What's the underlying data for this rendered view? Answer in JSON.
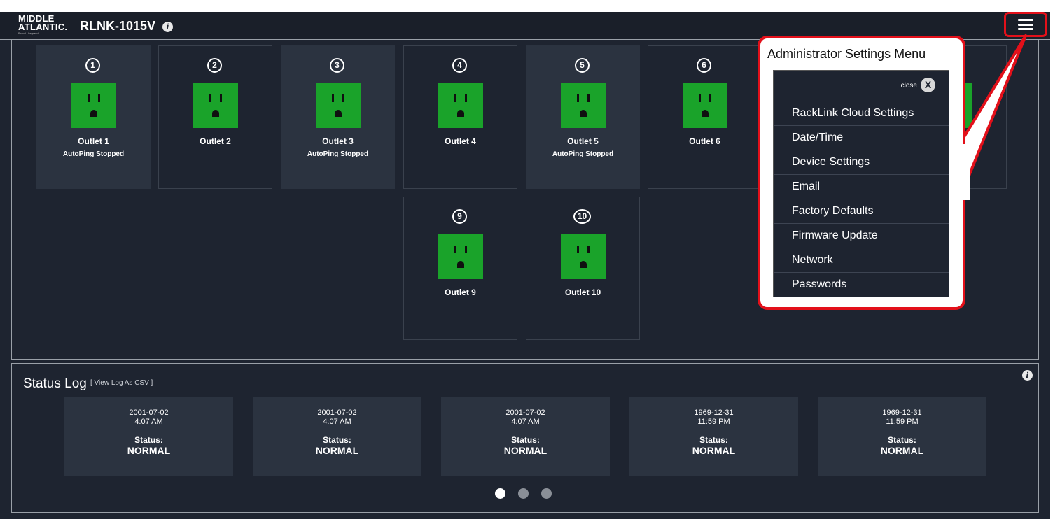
{
  "header": {
    "logo_line1": "MIDDLE",
    "logo_line2": "ATLANTIC.",
    "logo_tagline": "Brand / Legrand",
    "model": "RLNK-1015V",
    "info_icon": "i",
    "menu_icon": "hamburger-icon"
  },
  "outlets": [
    {
      "num": "1",
      "name": "Outlet 1",
      "status": "AutoPing Stopped"
    },
    {
      "num": "2",
      "name": "Outlet 2",
      "status": ""
    },
    {
      "num": "3",
      "name": "Outlet 3",
      "status": "AutoPing Stopped"
    },
    {
      "num": "4",
      "name": "Outlet 4",
      "status": ""
    },
    {
      "num": "5",
      "name": "Outlet 5",
      "status": "AutoPing Stopped"
    },
    {
      "num": "6",
      "name": "Outlet 6",
      "status": ""
    },
    {
      "num": "9",
      "name": "Outlet 9",
      "status": ""
    },
    {
      "num": "10",
      "name": "Outlet 10",
      "status": ""
    }
  ],
  "outlet_color": "#1aa32a",
  "status_log": {
    "title": "Status Log",
    "csv_link": "[ View Log As CSV ]",
    "info_icon": "i",
    "entries": [
      {
        "date": "2001-07-02",
        "time": "4:07 AM",
        "label": "Status:",
        "value": "NORMAL"
      },
      {
        "date": "2001-07-02",
        "time": "4:07 AM",
        "label": "Status:",
        "value": "NORMAL"
      },
      {
        "date": "2001-07-02",
        "time": "4:07 AM",
        "label": "Status:",
        "value": "NORMAL"
      },
      {
        "date": "1969-12-31",
        "time": "11:59 PM",
        "label": "Status:",
        "value": "NORMAL"
      },
      {
        "date": "1969-12-31",
        "time": "11:59 PM",
        "label": "Status:",
        "value": "NORMAL"
      }
    ],
    "pages": 3,
    "active_page": 1
  },
  "callout": {
    "title": "Administrator Settings Menu",
    "highlight_color": "#e3101a"
  },
  "admin_menu": {
    "close_label": "close",
    "close_icon": "X",
    "items": [
      "RackLink Cloud Settings",
      "Date/Time",
      "Device Settings",
      "Email",
      "Factory Defaults",
      "Firmware Update",
      "Network",
      "Passwords"
    ]
  }
}
